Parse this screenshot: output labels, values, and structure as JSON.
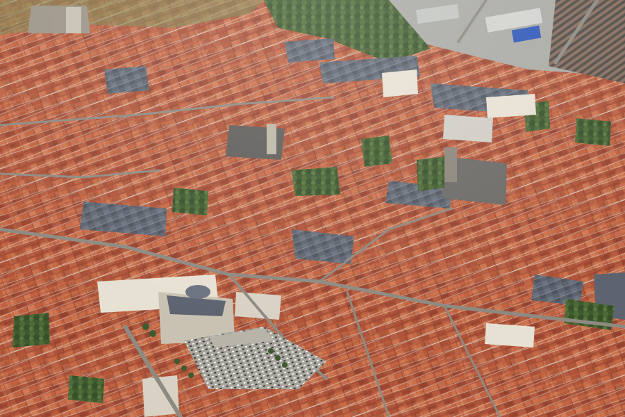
{
  "scene": {
    "palette": {
      "roof_red": "#b4553a",
      "roof_orange": "#c86a43",
      "roof_dark_red": "#8e3f2c",
      "roof_slate": "#5d6470",
      "roof_grey": "#8a8f96",
      "facade_light": "#d9d2c4",
      "facade_cream": "#e7e1d3",
      "vegetation": "#3f5a2e",
      "vegetation_light": "#6b8348",
      "pavement": "#9c9a93",
      "street": "#7d7a73",
      "parking": "#a7a49c",
      "car_white": "#f2f2f2",
      "car_dark": "#3a3a3a",
      "industrial_blue": "#2f58b8"
    }
  }
}
